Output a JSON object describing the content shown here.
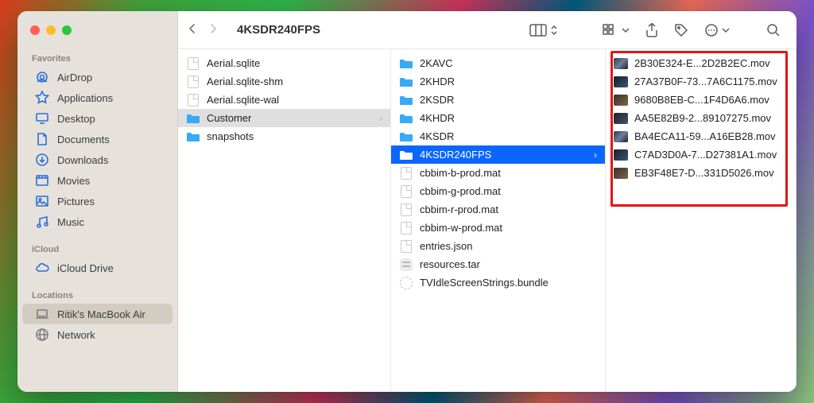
{
  "window_title": "4KSDR240FPS",
  "sidebar": {
    "sections": [
      {
        "title": "Favorites",
        "items": [
          {
            "label": "AirDrop",
            "icon": "airdrop"
          },
          {
            "label": "Applications",
            "icon": "apps"
          },
          {
            "label": "Desktop",
            "icon": "desktop"
          },
          {
            "label": "Documents",
            "icon": "documents"
          },
          {
            "label": "Downloads",
            "icon": "downloads"
          },
          {
            "label": "Movies",
            "icon": "movies"
          },
          {
            "label": "Pictures",
            "icon": "pictures"
          },
          {
            "label": "Music",
            "icon": "music"
          }
        ]
      },
      {
        "title": "iCloud",
        "items": [
          {
            "label": "iCloud Drive",
            "icon": "icloud"
          }
        ]
      },
      {
        "title": "Locations",
        "items": [
          {
            "label": "Ritik's MacBook Air",
            "icon": "laptop",
            "selected": true
          },
          {
            "label": "Network",
            "icon": "network"
          }
        ]
      }
    ]
  },
  "columns": [
    {
      "items": [
        {
          "label": "Aerial.sqlite",
          "type": "file"
        },
        {
          "label": "Aerial.sqlite-shm",
          "type": "file"
        },
        {
          "label": "Aerial.sqlite-wal",
          "type": "file"
        },
        {
          "label": "Customer",
          "type": "folder",
          "state": "selected-grey",
          "hasChildren": true
        },
        {
          "label": "snapshots",
          "type": "folder"
        }
      ]
    },
    {
      "items": [
        {
          "label": "2KAVC",
          "type": "folder"
        },
        {
          "label": "2KHDR",
          "type": "folder"
        },
        {
          "label": "2KSDR",
          "type": "folder"
        },
        {
          "label": "4KHDR",
          "type": "folder"
        },
        {
          "label": "4KSDR",
          "type": "folder"
        },
        {
          "label": "4KSDR240FPS",
          "type": "folder",
          "state": "selected-blue",
          "hasChildren": true
        },
        {
          "label": "cbbim-b-prod.mat",
          "type": "file"
        },
        {
          "label": "cbbim-g-prod.mat",
          "type": "file"
        },
        {
          "label": "cbbim-r-prod.mat",
          "type": "file"
        },
        {
          "label": "cbbim-w-prod.mat",
          "type": "file"
        },
        {
          "label": "entries.json",
          "type": "file"
        },
        {
          "label": "resources.tar",
          "type": "tar"
        },
        {
          "label": "TVIdleScreenStrings.bundle",
          "type": "bundle"
        }
      ]
    },
    {
      "items": [
        {
          "label": "2B30E324-E...2D2B2EC.mov",
          "type": "mov"
        },
        {
          "label": "27A37B0F-73...7A6C1175.mov",
          "type": "mov"
        },
        {
          "label": "9680B8EB-C...1F4D6A6.mov",
          "type": "mov"
        },
        {
          "label": "AA5E82B9-2...89107275.mov",
          "type": "mov"
        },
        {
          "label": "BA4ECA11-59...A16EB28.mov",
          "type": "mov"
        },
        {
          "label": "C7AD3D0A-7...D27381A1.mov",
          "type": "mov"
        },
        {
          "label": "EB3F48E7-D...331D5026.mov",
          "type": "mov"
        }
      ],
      "highlighted_box": true
    }
  ]
}
